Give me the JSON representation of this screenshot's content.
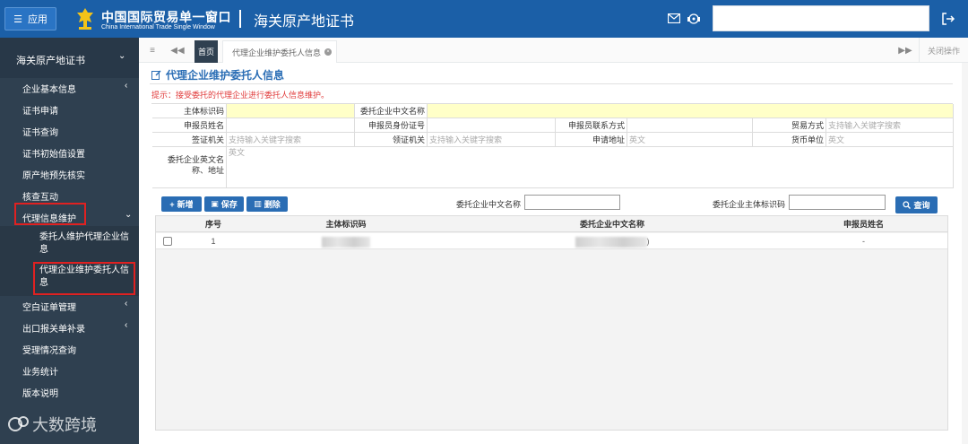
{
  "header": {
    "menu_label": "应用",
    "brand_cn": "中国国际贸易单一窗口",
    "brand_en": "China International Trade Single Window",
    "module": "海关原产地证书"
  },
  "sidebar": {
    "top": "海关原产地证书",
    "items": [
      {
        "label": "企业基本信息",
        "arrow": "‹"
      },
      {
        "label": "证书申请",
        "arrow": ""
      },
      {
        "label": "证书查询",
        "arrow": ""
      },
      {
        "label": "证书初始值设置",
        "arrow": ""
      },
      {
        "label": "原产地预先核实",
        "arrow": ""
      },
      {
        "label": "核查互动",
        "arrow": ""
      },
      {
        "label": "代理信息维护",
        "arrow": "⌄"
      }
    ],
    "subitems": [
      "委托人维护代理企业信息",
      "代理企业维护委托人信息"
    ],
    "items_after": [
      {
        "label": "空白证单管理",
        "arrow": "‹"
      },
      {
        "label": "出口报关单补录",
        "arrow": "‹"
      },
      {
        "label": "受理情况查询",
        "arrow": ""
      },
      {
        "label": "业务统计",
        "arrow": ""
      },
      {
        "label": "版本说明",
        "arrow": ""
      }
    ],
    "watermark": "大数跨境"
  },
  "tabs": {
    "home": "首页",
    "active": "代理企业维护委托人信息",
    "close_ops": "关闭操作"
  },
  "page": {
    "heading": "代理企业维护委托人信息",
    "tip": "提示：接受委托的代理企业进行委托人信息维护。"
  },
  "form": {
    "main_id_label": "主体标识码",
    "entrust_cn_label": "委托企业中文名称",
    "declarant_name_label": "申报员姓名",
    "declarant_id_label": "申报员身份证号",
    "declarant_contact_label": "申报员联系方式",
    "trade_mode_label": "贸易方式",
    "trade_mode_placeholder": "支持输入关键字搜索",
    "visa_org_label": "签证机关",
    "visa_org_placeholder": "支持输入关键字搜索",
    "cert_org_label": "领证机关",
    "cert_org_placeholder": "支持输入关键字搜索",
    "apply_addr_label": "申请地址",
    "apply_addr_placeholder": "英文",
    "currency_label": "货币单位",
    "currency_placeholder": "英文",
    "entrust_en_label": "委托企业英文名称、地址",
    "entrust_en_placeholder": "英文"
  },
  "toolbar": {
    "add": "新增",
    "save": "保存",
    "delete": "删除",
    "q_cn_name_label": "委托企业中文名称",
    "q_main_id_label": "委托企业主体标识码",
    "search": "查询"
  },
  "table": {
    "columns": [
      "序号",
      "主体标识码",
      "委托企业中文名称",
      "申报员姓名"
    ],
    "rows": [
      {
        "index": "1",
        "main_id": "",
        "cn_name_suffix": ")",
        "declarant": "-"
      }
    ]
  }
}
